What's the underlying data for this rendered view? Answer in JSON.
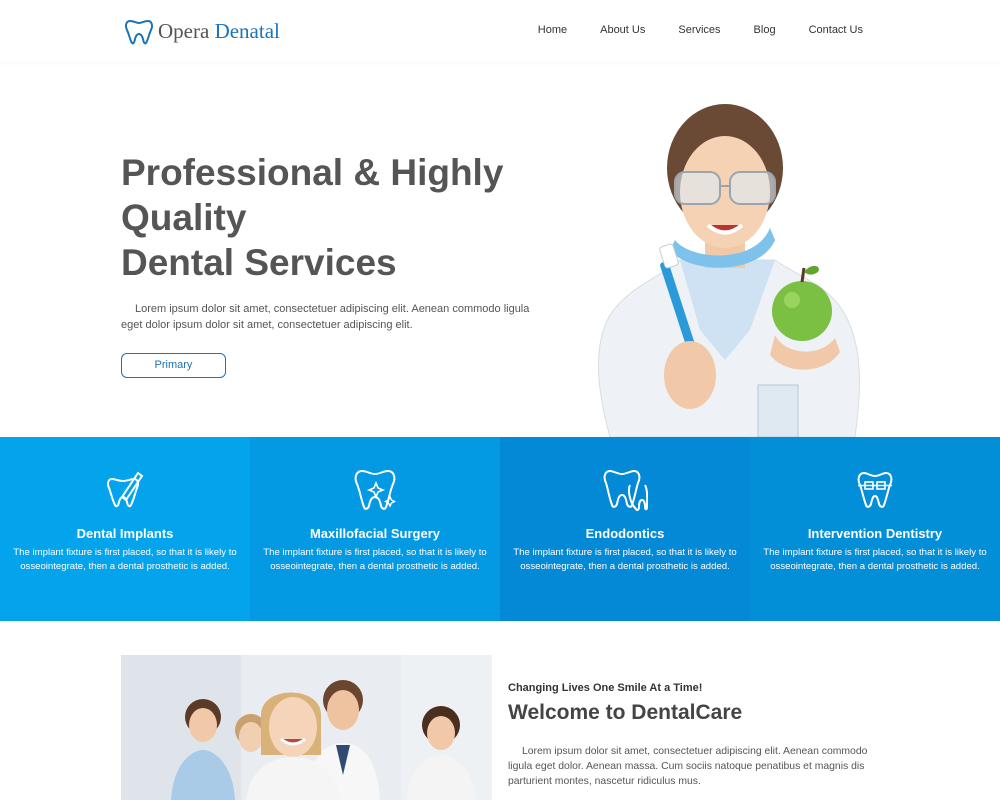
{
  "brand": {
    "name_part1": "Opera",
    "name_part2": "Denatal"
  },
  "nav": [
    "Home",
    "About Us",
    "Services",
    "Blog",
    "Contact Us"
  ],
  "hero": {
    "title_lines": [
      "Professional & Highly",
      "Quality",
      "Dental Services"
    ],
    "text": "Lorem ipsum dolor sit amet, consectetuer adipiscing elit. Aenean commodo ligula eget dolor ipsum dolor sit amet, consectetuer adipiscing elit.",
    "button_label": "Primary"
  },
  "services": [
    {
      "icon": "dental-implant-icon",
      "title": "Dental Implants",
      "desc": "The implant fixture is first placed, so that it is likely to osseointegrate, then a dental prosthetic is added."
    },
    {
      "icon": "sparkle-tooth-icon",
      "title": "Maxillofacial Surgery",
      "desc": "The implant fixture is first placed, so that it is likely to osseointegrate, then a dental prosthetic is added."
    },
    {
      "icon": "teeth-icon",
      "title": "Endodontics",
      "desc": "The implant fixture is first placed, so that it is likely to osseointegrate, then a dental prosthetic is added."
    },
    {
      "icon": "braces-tooth-icon",
      "title": "Intervention Dentistry",
      "desc": "The implant fixture is first placed, so that it is likely to osseointegrate, then a dental prosthetic is added."
    }
  ],
  "about": {
    "tagline": "Changing Lives One Smile At a Time!",
    "title": "Welcome to DentalCare",
    "text": "Lorem ipsum dolor sit amet, consectetuer adipiscing elit. Aenean commodo ligula eget dolor. Aenean massa. Cum sociis natoque penatibus et magnis dis parturient montes, nascetur ridiculus mus."
  },
  "colors": {
    "accent": "#1b73b8",
    "service_band": [
      "#03a4ec",
      "#0499e3",
      "#0389d5",
      "#038ed8"
    ]
  }
}
